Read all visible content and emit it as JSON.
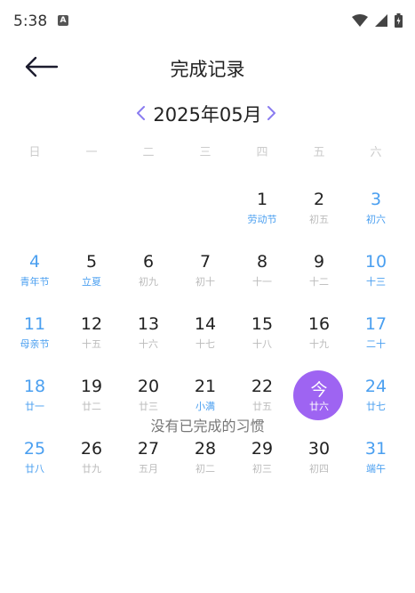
{
  "status_bar": {
    "time": "5:38",
    "a_icon": "A",
    "icons": [
      "wifi-icon",
      "signal-icon",
      "battery-icon"
    ]
  },
  "header": {
    "title": "完成记录",
    "back_icon": "arrow-left-icon"
  },
  "month_nav": {
    "label": "2025年05月",
    "prev_icon": "chevron-left-icon",
    "next_icon": "chevron-right-icon"
  },
  "weekdays": [
    "日",
    "一",
    "二",
    "三",
    "四",
    "五",
    "六"
  ],
  "calendar": {
    "weeks": [
      [
        {
          "day": "",
          "sub": ""
        },
        {
          "day": "",
          "sub": ""
        },
        {
          "day": "",
          "sub": ""
        },
        {
          "day": "",
          "sub": ""
        },
        {
          "day": "1",
          "sub": "劳动节",
          "festival": true
        },
        {
          "day": "2",
          "sub": "初五"
        },
        {
          "day": "3",
          "sub": "初六"
        }
      ],
      [
        {
          "day": "4",
          "sub": "青年节",
          "festival": true
        },
        {
          "day": "5",
          "sub": "立夏",
          "festival": true
        },
        {
          "day": "6",
          "sub": "初九"
        },
        {
          "day": "7",
          "sub": "初十"
        },
        {
          "day": "8",
          "sub": "十一"
        },
        {
          "day": "9",
          "sub": "十二"
        },
        {
          "day": "10",
          "sub": "十三"
        }
      ],
      [
        {
          "day": "11",
          "sub": "母亲节",
          "festival": true
        },
        {
          "day": "12",
          "sub": "十五"
        },
        {
          "day": "13",
          "sub": "十六"
        },
        {
          "day": "14",
          "sub": "十七"
        },
        {
          "day": "15",
          "sub": "十八"
        },
        {
          "day": "16",
          "sub": "十九"
        },
        {
          "day": "17",
          "sub": "二十"
        }
      ],
      [
        {
          "day": "18",
          "sub": "廿一"
        },
        {
          "day": "19",
          "sub": "廿二"
        },
        {
          "day": "20",
          "sub": "廿三"
        },
        {
          "day": "21",
          "sub": "小满",
          "festival": true
        },
        {
          "day": "22",
          "sub": "廿五"
        },
        {
          "day": "今",
          "sub": "廿六",
          "today": true
        },
        {
          "day": "24",
          "sub": "廿七"
        }
      ],
      [
        {
          "day": "25",
          "sub": "廿八"
        },
        {
          "day": "26",
          "sub": "廿九"
        },
        {
          "day": "27",
          "sub": "五月"
        },
        {
          "day": "28",
          "sub": "初二"
        },
        {
          "day": "29",
          "sub": "初三"
        },
        {
          "day": "30",
          "sub": "初四"
        },
        {
          "day": "31",
          "sub": "端午"
        }
      ]
    ]
  },
  "empty_message": "没有已完成的习惯",
  "colors": {
    "accent_purple": "#9e64f2",
    "weekend_blue": "#4a9ff0",
    "nav_arrow": "#8a7cf0"
  }
}
